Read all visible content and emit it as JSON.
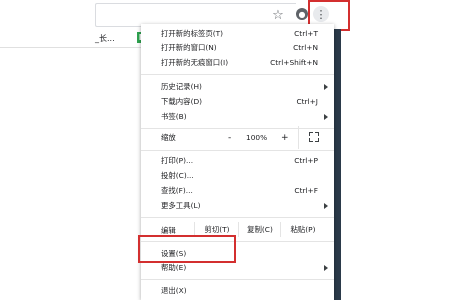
{
  "toolbar": {
    "star_icon": "star-outline-icon",
    "avatar_icon": "account-circle-icon",
    "menu_icon": "more-vert-icon",
    "menu_glyph": "⋮",
    "star_glyph": "☆",
    "highlight_color": "#d32f2f"
  },
  "bookmarks": {
    "item1": "_长...",
    "item2": "E"
  },
  "menu": {
    "new_tab": {
      "label": "打开新的标签页(T)",
      "shortcut": "Ctrl+T"
    },
    "new_window": {
      "label": "打开新的窗口(N)",
      "shortcut": "Ctrl+N"
    },
    "incognito": {
      "label": "打开新的无痕窗口(I)",
      "shortcut": "Ctrl+Shift+N"
    },
    "history": {
      "label": "历史记录(H)"
    },
    "downloads": {
      "label": "下载内容(D)",
      "shortcut": "Ctrl+J"
    },
    "bookmarks": {
      "label": "书签(B)"
    },
    "zoom": {
      "label": "缩放",
      "minus": "-",
      "value": "100%",
      "plus": "+"
    },
    "print": {
      "label": "打印(P)...",
      "shortcut": "Ctrl+P"
    },
    "cast": {
      "label": "投射(C)..."
    },
    "find": {
      "label": "查找(F)...",
      "shortcut": "Ctrl+F"
    },
    "more_tools": {
      "label": "更多工具(L)"
    },
    "edit": {
      "label": "编辑",
      "cut": "剪切(T)",
      "copy": "复制(C)",
      "paste": "粘贴(P)"
    },
    "settings": {
      "label": "设置(S)"
    },
    "help": {
      "label": "帮助(E)"
    },
    "exit": {
      "label": "退出(X)"
    }
  }
}
